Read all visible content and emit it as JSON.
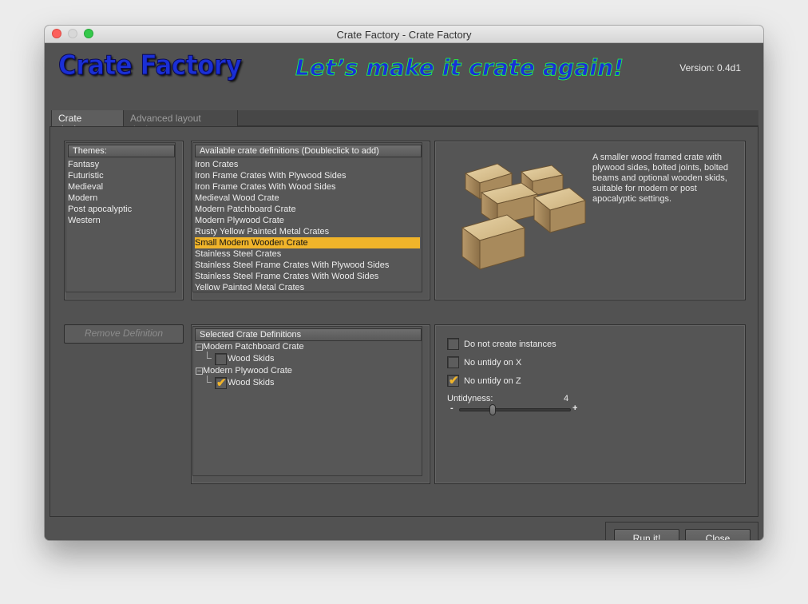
{
  "window": {
    "title": "Crate Factory - Crate Factory"
  },
  "header": {
    "logo": "Crate Factory",
    "slogan": "Let’s make it crate again!",
    "version": "Version: 0.4d1"
  },
  "tabs": [
    {
      "label": "Crate designs",
      "active": true
    },
    {
      "label": "Advanced layout design",
      "active": false
    }
  ],
  "themes": {
    "header": "Themes:",
    "items": [
      "Fantasy",
      "Futuristic",
      "Medieval",
      "Modern",
      "Post apocalyptic",
      "Western"
    ]
  },
  "available": {
    "header": "Available crate definitions (Doubleclick to add)",
    "items": [
      "Iron Crates",
      "Iron Frame Crates With Plywood Sides",
      "Iron Frame Crates With Wood Sides",
      "Medieval Wood Crate",
      "Modern Patchboard Crate",
      "Modern Plywood Crate",
      "Rusty Yellow Painted Metal Crates",
      "Small Modern Wooden Crate",
      "Stainless Steel Crates",
      "Stainless Steel Frame Crates With Plywood Sides",
      "Stainless Steel Frame Crates With Wood Sides",
      "Yellow Painted Metal Crates"
    ],
    "selected_index": 7
  },
  "preview": {
    "description": "A smaller wood framed crate with plywood sides, bolted joints, bolted beams and optional wooden skids, suitable for modern or post apocalyptic settings."
  },
  "remove_button": "Remove Definition",
  "selected_defs": {
    "header": "Selected Crate Definitions",
    "groups": [
      {
        "name": "Modern Patchboard Crate",
        "child": "Wood Skids",
        "checked": false
      },
      {
        "name": "Modern Plywood Crate",
        "child": "Wood Skids",
        "checked": true
      }
    ]
  },
  "options": {
    "no_instances": {
      "label": "Do not create instances",
      "checked": false
    },
    "no_untidy_x": {
      "label": "No untidy on X",
      "checked": false
    },
    "no_untidy_z": {
      "label": "No untidy on Z",
      "checked": true
    },
    "untidyness_label": "Untidyness:",
    "untidyness_value": "4",
    "slider_min_symbol": "-",
    "slider_max_symbol": "+",
    "slider_fraction": 0.3
  },
  "buttons": {
    "run": "Run it!",
    "close": "Close"
  },
  "colors": {
    "accent": "#f0b42a",
    "logo_blue": "#1a2fd6",
    "slogan_outline": "#22ff44"
  }
}
